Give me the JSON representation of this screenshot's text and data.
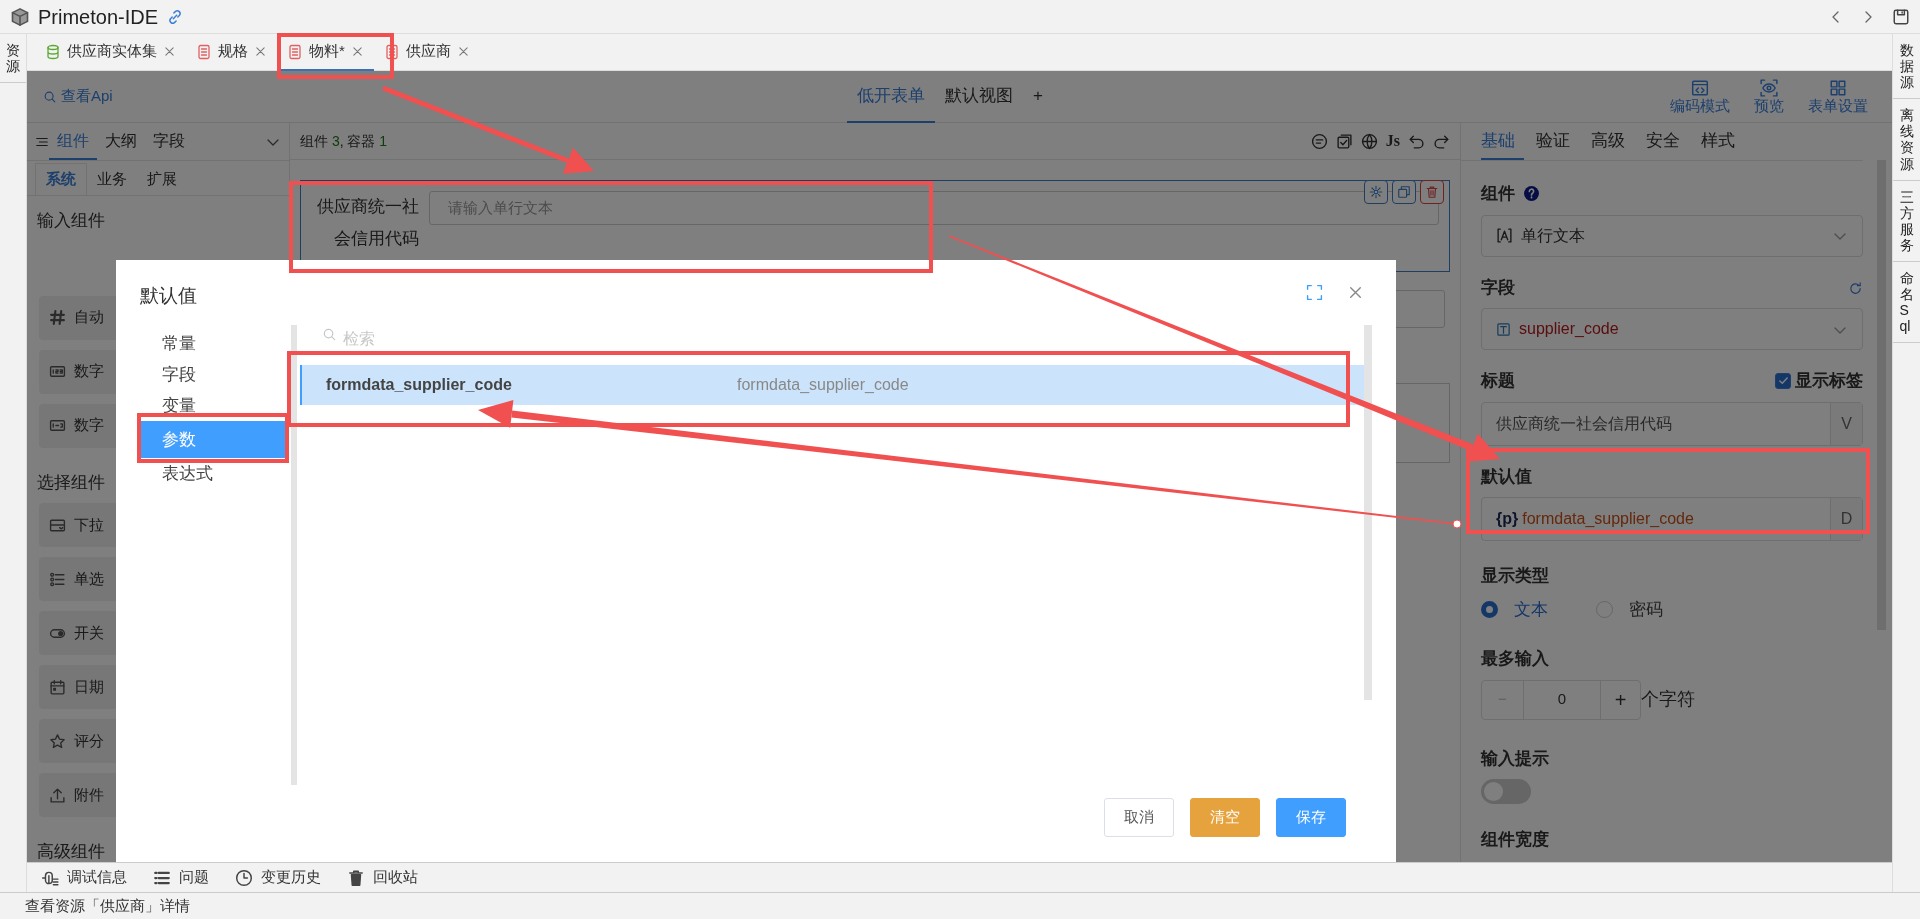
{
  "app": {
    "title": "Primeton-IDE"
  },
  "left_dock": [
    {
      "label": "资源"
    }
  ],
  "right_dock": [
    {
      "label": "数据源"
    },
    {
      "label": "离线资源"
    },
    {
      "label": "三方服务"
    },
    {
      "label": "命名Sql"
    }
  ],
  "editor_tabs": [
    {
      "label": "供应商实体集",
      "kind": "entity",
      "selected": false
    },
    {
      "label": "规格",
      "kind": "form",
      "selected": false
    },
    {
      "label": "物料*",
      "kind": "form",
      "selected": true
    },
    {
      "label": "供应商",
      "kind": "form",
      "selected": false
    }
  ],
  "designer": {
    "api_link": "查看Api",
    "view_tabs": [
      {
        "label": "低开表单",
        "selected": true
      },
      {
        "label": "默认视图",
        "selected": false
      }
    ],
    "add_view": "+",
    "actions": [
      {
        "label": "编码模式"
      },
      {
        "label": "预览"
      },
      {
        "label": "表单设置"
      }
    ]
  },
  "palette": {
    "tabs": [
      {
        "label": "组件",
        "selected": true
      },
      {
        "label": "大纲",
        "selected": false
      },
      {
        "label": "字段",
        "selected": false
      }
    ],
    "subtabs": [
      {
        "label": "系统",
        "selected": true
      },
      {
        "label": "业务",
        "selected": false
      },
      {
        "label": "扩展",
        "selected": false
      }
    ],
    "groups": [
      {
        "title": "输入组件",
        "items": [
          {
            "label": "自动"
          },
          {
            "label": "数字"
          },
          {
            "label": "数字"
          }
        ]
      },
      {
        "title": "选择组件",
        "items": [
          {
            "label": "下拉"
          },
          {
            "label": "单选"
          },
          {
            "label": "开关"
          },
          {
            "label": "日期"
          },
          {
            "label": "评分"
          },
          {
            "label": "附件"
          }
        ]
      },
      {
        "title": "高级组件"
      }
    ]
  },
  "canvas": {
    "summary": [
      {
        "text": "组件 "
      },
      {
        "text": "3",
        "kind": "count"
      },
      {
        "text": ", 容器 "
      },
      {
        "text": "1",
        "kind": "count"
      }
    ],
    "js_button": "Js",
    "field": {
      "label": "供应商统一社会信用代码",
      "placeholder": "请输入单行文本"
    }
  },
  "properties": {
    "tabs": [
      {
        "label": "基础",
        "selected": true
      },
      {
        "label": "验证",
        "selected": false
      },
      {
        "label": "高级",
        "selected": false
      },
      {
        "label": "安全",
        "selected": false
      },
      {
        "label": "样式",
        "selected": false
      }
    ],
    "component": {
      "label": "组件",
      "value": "单行文本"
    },
    "field": {
      "label": "字段",
      "value": "supplier_code"
    },
    "title": {
      "label": "标题",
      "show_label": {
        "label": "显示标签",
        "checked": true
      },
      "value": "供应商统一社会信用代码",
      "addon": "V"
    },
    "default_value": {
      "label": "默认值",
      "prefix": "{p}",
      "value": "formdata_supplier_code",
      "addon": "D"
    },
    "display_type": {
      "label": "显示类型",
      "options": [
        {
          "label": "文本",
          "selected": true
        },
        {
          "label": "密码",
          "selected": false
        }
      ]
    },
    "max_length": {
      "label": "最多输入",
      "minus": "−",
      "value": "0",
      "plus": "+",
      "suffix": "个字符"
    },
    "hint": {
      "label": "输入提示",
      "on": false
    },
    "width": {
      "label": "组件宽度"
    }
  },
  "dialog": {
    "title": "默认值",
    "categories": [
      {
        "label": "常量",
        "selected": false
      },
      {
        "label": "字段",
        "selected": false
      },
      {
        "label": "变量",
        "selected": false
      },
      {
        "label": "参数",
        "selected": true
      },
      {
        "label": "表达式",
        "selected": false
      }
    ],
    "search": {
      "placeholder": "检索"
    },
    "rows": [
      {
        "name": "formdata_supplier_code",
        "description": "formdata_supplier_code",
        "selected": true
      }
    ],
    "buttons": [
      {
        "label": "取消",
        "kind": "default"
      },
      {
        "label": "清空",
        "kind": "warning"
      },
      {
        "label": "保存",
        "kind": "primary"
      }
    ]
  },
  "bottom_tools": [
    {
      "label": "调试信息"
    },
    {
      "label": "问题"
    },
    {
      "label": "变更历史"
    },
    {
      "label": "回收站"
    }
  ],
  "status_bar": {
    "text": "查看资源「供应商」详情"
  }
}
